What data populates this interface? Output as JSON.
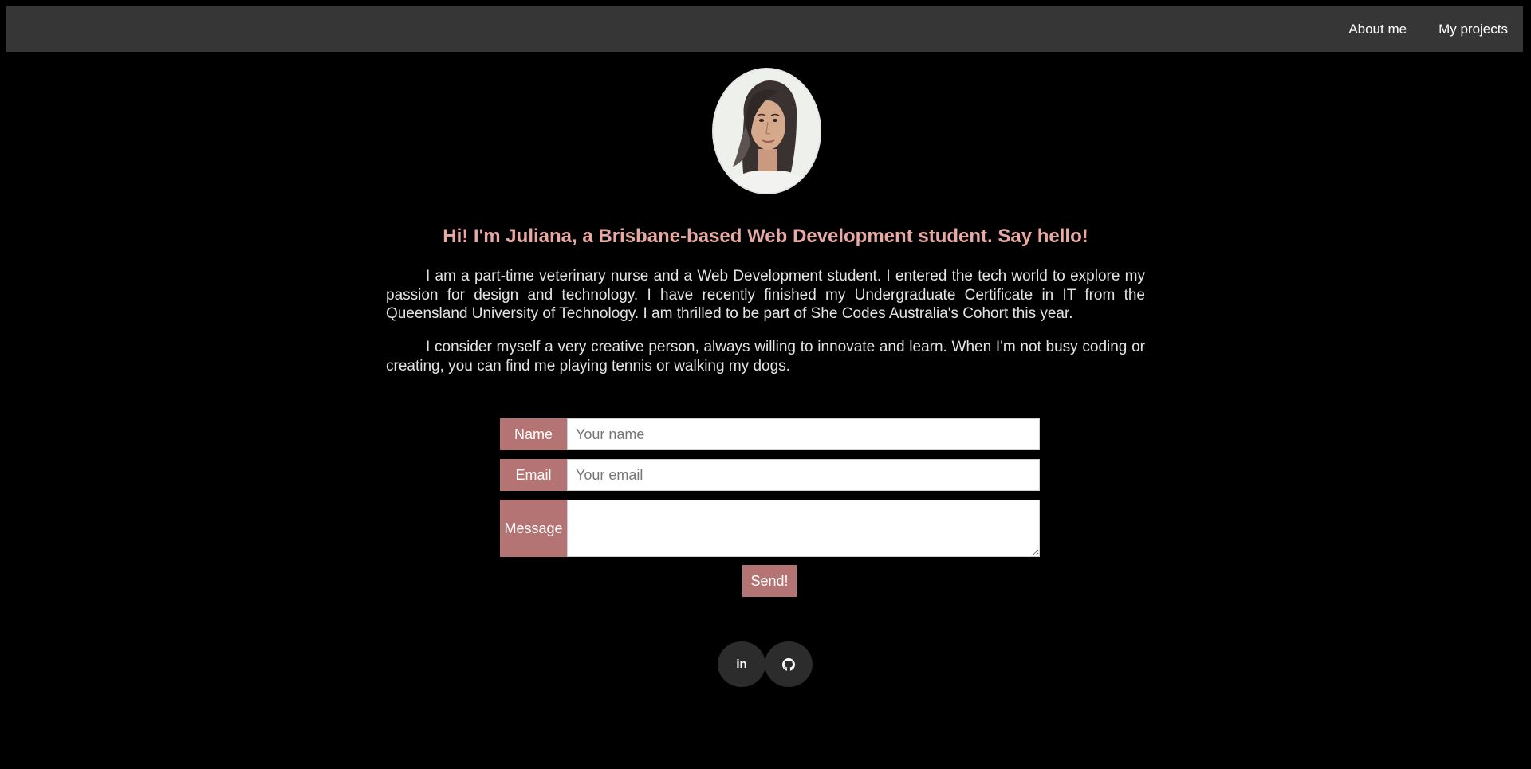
{
  "nav": {
    "about": "About me",
    "projects": "My projects"
  },
  "hero": {
    "headline": "Hi! I'm Juliana, a Brisbane-based Web Development student. Say hello!",
    "bio_1": "I am a part-time veterinary nurse and a Web Development student. I entered the tech world to explore my passion for design and technology. I have recently finished my Undergraduate Certificate in IT from the Queensland University of Technology. I am thrilled to be part of She Codes Australia's Cohort this year.",
    "bio_2": "I consider myself a very creative person, always willing to innovate and learn. When I'm not busy coding or creating, you can find me playing tennis or walking my dogs."
  },
  "form": {
    "name_label": "Name",
    "name_placeholder": "Your name",
    "email_label": "Email",
    "email_placeholder": "Your email",
    "message_label": "Message",
    "send_label": "Send!"
  },
  "social": {
    "linkedin_icon": "linkedin-icon",
    "github_icon": "github-icon",
    "linkedin_text": "in"
  },
  "colors": {
    "accent": "#b57474",
    "headline": "#e8a9a3",
    "navbar": "#363636",
    "background": "#000000"
  }
}
